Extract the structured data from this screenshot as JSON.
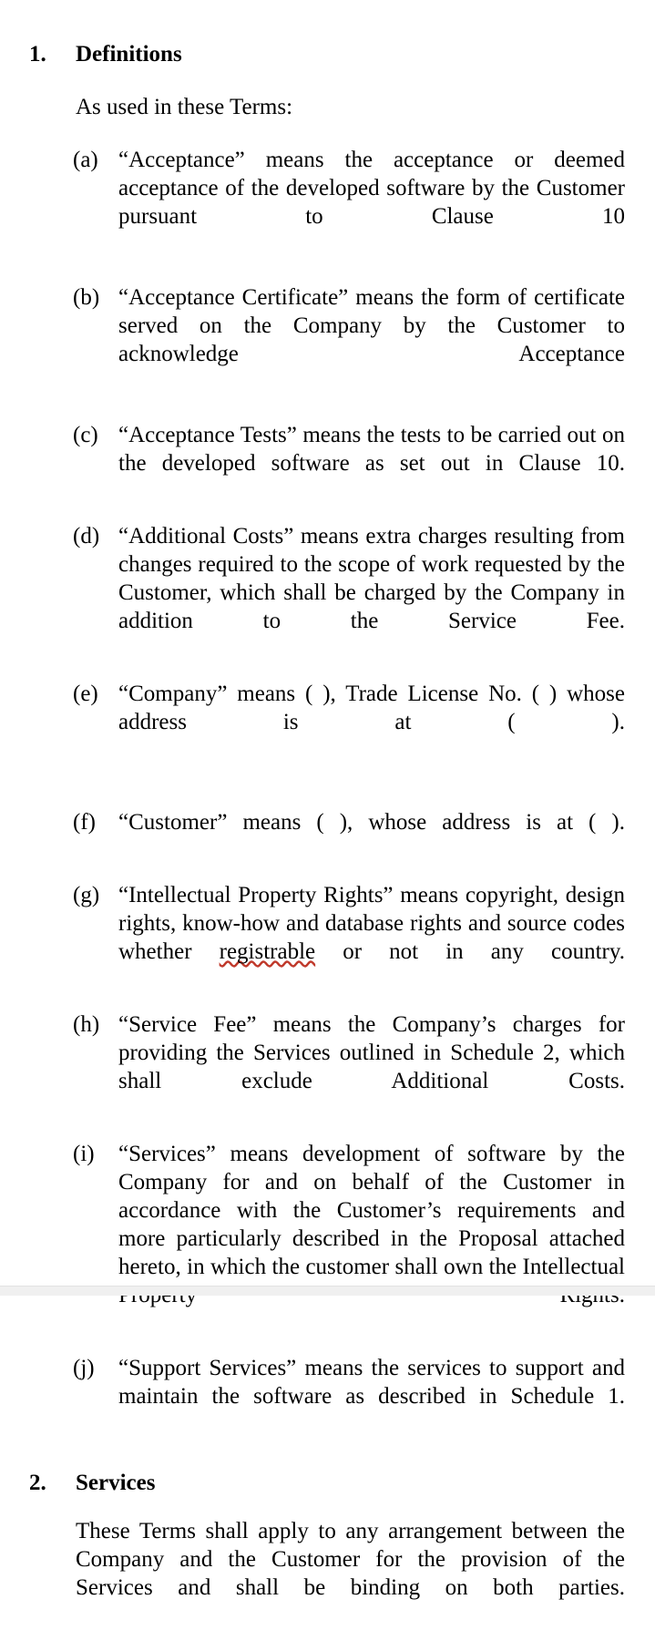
{
  "document": {
    "sections": [
      {
        "number": "1.",
        "title": "Definitions",
        "lead": "As used in these Terms:",
        "items": [
          {
            "label": "(a)",
            "text": "“Acceptance” means the acceptance or deemed acceptance of the developed software by the Customer pursuant to Clause 10"
          },
          {
            "label": "(b)",
            "text": "“Acceptance Certificate” means the form of certificate served on the Company by the Customer to acknowledge Acceptance"
          },
          {
            "label": "(c)",
            "text": "“Acceptance Tests” means the tests to be carried out on the developed software as set out in Clause 10."
          },
          {
            "label": "(d)",
            "text": "“Additional Costs” means extra charges resulting from changes required to the scope of work requested by the Customer, which shall be charged by the Company in addition to the Service Fee."
          },
          {
            "label": "(e)",
            "text": "“Company” means (  ), Trade License No. (  ) whose address is at (   )."
          },
          {
            "label": "(f)",
            "text": "“Customer” means (  ), whose address is at (  )."
          },
          {
            "label": "(g)",
            "text_before": "“Intellectual Property Rights” means copyright, design rights, know-how and database rights and source codes whether ",
            "misspelled_word": "registrable",
            "text_after": " or not in any country."
          },
          {
            "label": "(h)",
            "text": "“Service Fee” means the Company’s charges for providing the Services outlined in Schedule 2, which shall exclude Additional Costs."
          },
          {
            "label": "(i)",
            "text": "“Services” means development of software by the Company for and on behalf of the Customer in accordance with the Customer’s requirements and more particularly described in the Proposal attached hereto, in which the customer shall own the Intellectual Property Rights."
          },
          {
            "label": "(j)",
            "text": "“Support Services” means the services to support and maintain the software as described in Schedule 1."
          }
        ]
      },
      {
        "number": "2.",
        "title": "Services",
        "body": "These Terms shall apply to any arrangement between the Company and the Customer for the provision of the Services and shall be binding on both parties."
      }
    ]
  },
  "style": {
    "text_color": "#000000",
    "background_color": "#ffffff",
    "spellcheck_underline_color": "#c0392b",
    "bottom_rule_color": "#f0f0f0"
  }
}
